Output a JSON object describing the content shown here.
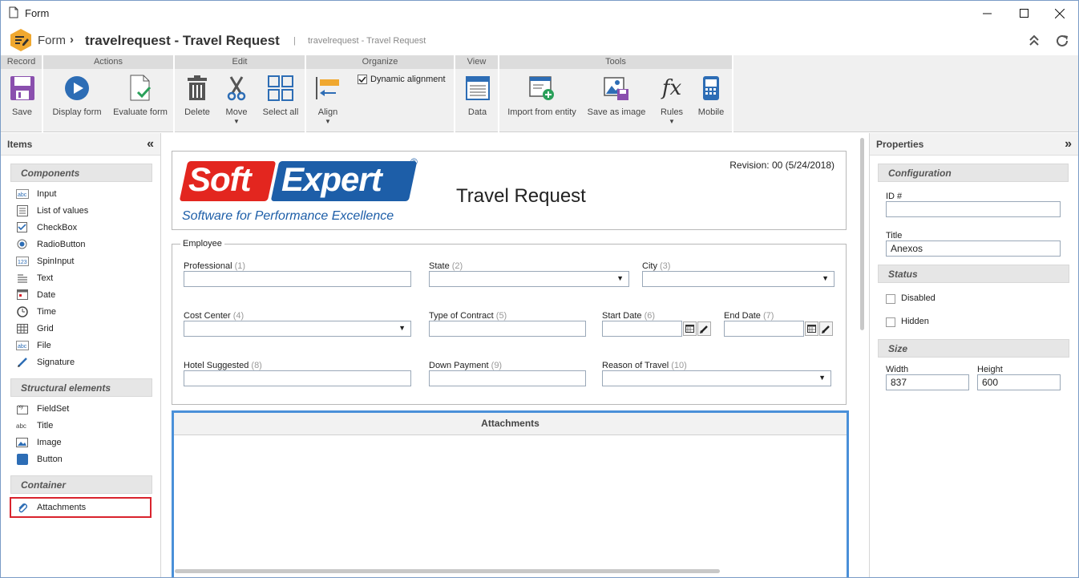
{
  "window": {
    "title": "Form"
  },
  "header": {
    "breadcrumb_root": "Form",
    "title": "travelrequest - Travel Request",
    "subtitle": "travelrequest - Travel Request"
  },
  "ribbon": {
    "groups": {
      "record": "Record",
      "actions": "Actions",
      "edit": "Edit",
      "organize": "Organize",
      "view": "View",
      "tools": "Tools"
    },
    "buttons": {
      "save": "Save",
      "display_form": "Display form",
      "evaluate_form": "Evaluate form",
      "delete": "Delete",
      "move": "Move",
      "select_all": "Select all",
      "align": "Align",
      "dynamic_alignment": "Dynamic alignment",
      "data": "Data",
      "import_from_entity": "Import from entity",
      "save_as_image": "Save as image",
      "rules": "Rules",
      "mobile": "Mobile"
    },
    "dynamic_alignment_checked": true
  },
  "left_panel": {
    "title": "Items",
    "sections": [
      {
        "title": "Components",
        "items": [
          "Input",
          "List of values",
          "CheckBox",
          "RadioButton",
          "SpinInput",
          "Text",
          "Date",
          "Time",
          "Grid",
          "File",
          "Signature"
        ]
      },
      {
        "title": "Structural elements",
        "items": [
          "FieldSet",
          "Title",
          "Image",
          "Button"
        ]
      },
      {
        "title": "Container",
        "items": [
          "Attachments"
        ]
      }
    ]
  },
  "form": {
    "logo": {
      "brand_left": "Soft",
      "brand_right": "Expert",
      "tagline": "Software for Performance Excellence",
      "registered": "®"
    },
    "heading": "Travel Request",
    "revision": "Revision: 00 (5/24/2018)",
    "fieldset_legend": "Employee",
    "fields": [
      {
        "label": "Professional",
        "num": "(1)"
      },
      {
        "label": "State",
        "num": "(2)"
      },
      {
        "label": "City",
        "num": "(3)"
      },
      {
        "label": "Cost Center",
        "num": "(4)"
      },
      {
        "label": "Type of Contract",
        "num": "(5)"
      },
      {
        "label": "Start Date",
        "num": "(6)"
      },
      {
        "label": "End Date",
        "num": "(7)"
      },
      {
        "label": "Hotel Suggested",
        "num": "(8)"
      },
      {
        "label": "Down Payment",
        "num": "(9)"
      },
      {
        "label": "Reason of Travel",
        "num": "(10)"
      }
    ],
    "attachments_title": "Attachments"
  },
  "right_panel": {
    "title": "Properties",
    "configuration": "Configuration",
    "id_label": "ID #",
    "id_value": "",
    "title_label": "Title",
    "title_value": "Anexos",
    "status": "Status",
    "disabled": "Disabled",
    "hidden": "Hidden",
    "size": "Size",
    "width_label": "Width",
    "width_value": "837",
    "height_label": "Height",
    "height_value": "600"
  },
  "colors": {
    "accent": "#4a90d9",
    "selected_border": "#d9232d",
    "logo_red": "#e3261f",
    "logo_blue": "#1d5ea8"
  }
}
